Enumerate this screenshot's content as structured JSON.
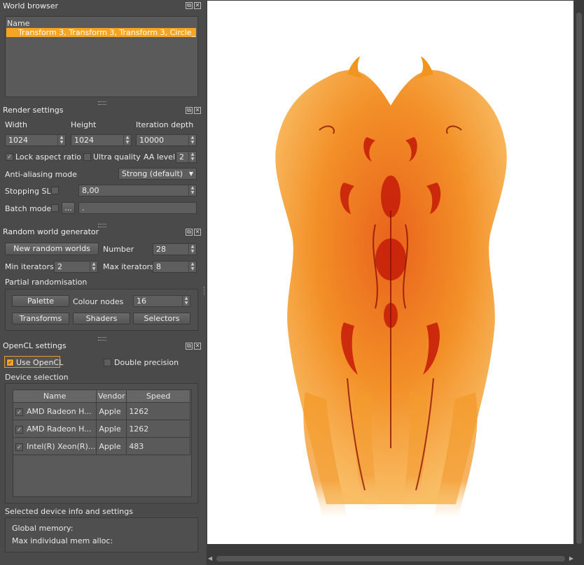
{
  "world_browser": {
    "title": "World browser",
    "column_name": "Name",
    "selected_world": "Transform 3, Transform 3, Transform 3, Circle_..."
  },
  "render_settings": {
    "title": "Render settings",
    "width_label": "Width",
    "height_label": "Height",
    "iteration_label": "Iteration depth",
    "width_value": "1024",
    "height_value": "1024",
    "iteration_value": "10000",
    "lock_aspect_label": "Lock aspect ratio",
    "ultra_quality_label": "Ultra quality",
    "aa_level_label": "AA level",
    "aa_level_value": "2",
    "aa_mode_label": "Anti-aliasing mode",
    "aa_mode_value": "Strong (default)",
    "stopping_label": "Stopping SL",
    "stopping_value": "8,00",
    "batch_label": "Batch mode",
    "batch_button": "...",
    "batch_value": "."
  },
  "random_world_generator": {
    "title": "Random world generator",
    "new_button": "New random worlds",
    "number_label": "Number",
    "number_value": "28",
    "min_label": "Min iterators",
    "min_value": "2",
    "max_label": "Max iterators",
    "max_value": "8",
    "partial_label": "Partial randomisation",
    "palette_button": "Palette",
    "colour_nodes_label": "Colour nodes",
    "colour_nodes_value": "16",
    "transforms_button": "Transforms",
    "shaders_button": "Shaders",
    "selectors_button": "Selectors"
  },
  "opencl_settings": {
    "title": "OpenCL settings",
    "use_opencl_label": "Use OpenCL",
    "double_precision_label": "Double precision",
    "device_selection_label": "Device selection",
    "columns": [
      "Name",
      "Vendor",
      "Speed"
    ],
    "devices": [
      {
        "name": "AMD Radeon H...",
        "vendor": "Apple",
        "speed": "1262"
      },
      {
        "name": "AMD Radeon H...",
        "vendor": "Apple",
        "speed": "1262"
      },
      {
        "name": "Intel(R) Xeon(R)...",
        "vendor": "Apple",
        "speed": "483"
      }
    ],
    "device_info_label": "Selected device info and settings",
    "global_memory_label": "Global memory:",
    "max_alloc_label": "Max individual mem alloc:"
  },
  "colors": {
    "selection": "#f5a523",
    "flame_outer": "#f7a83a",
    "flame_mid": "#f28a1c",
    "flame_core": "#c8200a"
  },
  "icons": {
    "panel_float": "float-icon",
    "panel_close": "close-icon",
    "spin_arrows": "spin-arrows-icon",
    "dropdown": "chevron-down-icon"
  }
}
